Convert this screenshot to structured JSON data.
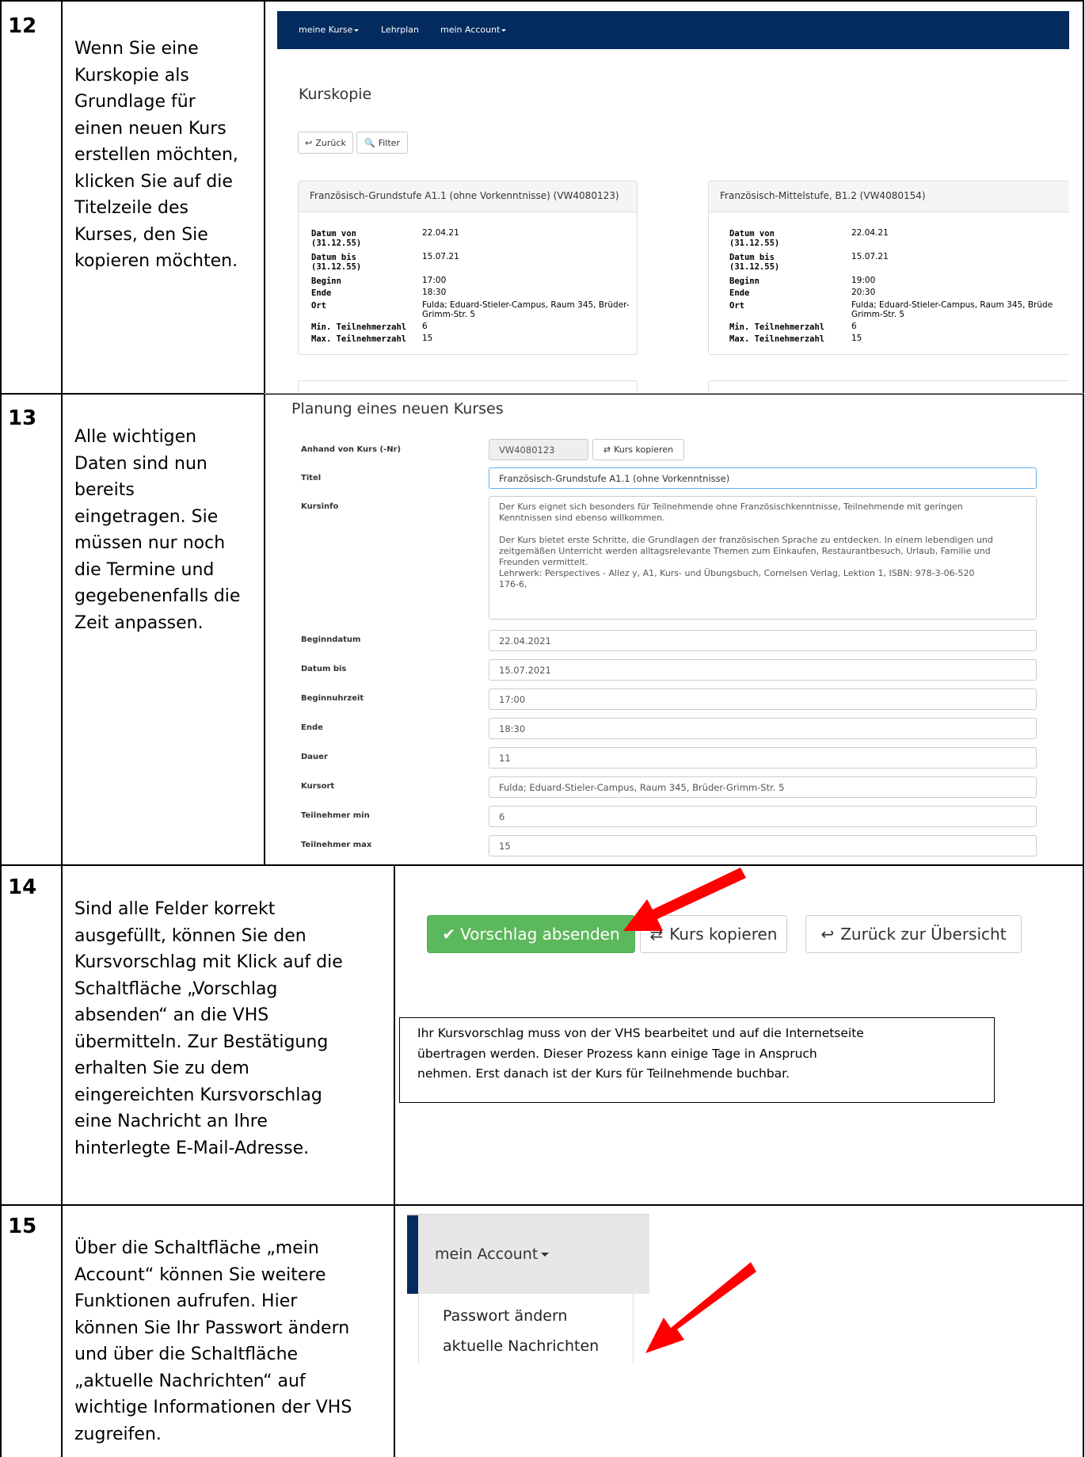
{
  "steps": [
    {
      "num": "12",
      "lines": [
        "Wenn Sie eine",
        "Kurskopie als",
        "Grundlage für",
        "einen neuen Kurs",
        "erstellen möchten,",
        "klicken Sie auf die",
        "Titelzeile des",
        "Kurses, den Sie",
        "kopieren möchten."
      ]
    },
    {
      "num": "13",
      "lines": [
        "Alle wichtigen",
        "Daten sind nun",
        "bereits",
        "eingetragen. Sie",
        "müssen nur noch",
        "die Termine und",
        "gegebenenfalls die",
        "Zeit anpassen."
      ]
    },
    {
      "num": "14",
      "lines": [
        "Sind alle Felder korrekt",
        "ausgefüllt, können Sie den",
        "Kursvorschlag mit Klick auf die",
        "Schaltfläche „Vorschlag",
        "absenden“ an die VHS",
        "übermitteln. Zur Bestätigung",
        "erhalten Sie zu dem",
        "eingereichten Kursvorschlag",
        "eine Nachricht an Ihre",
        "hinterlegte E-Mail-Adresse."
      ]
    },
    {
      "num": "15",
      "lines": [
        "Über die Schaltfläche „mein",
        "Account“ können Sie weitere",
        "Funktionen aufrufen. Hier",
        "können Sie Ihr Passwort ändern",
        "und über die Schaltfläche",
        "„aktuelle Nachrichten“ auf",
        "wichtige Informationen der VHS",
        "zugreifen."
      ]
    }
  ],
  "shot12": {
    "nav": [
      "meine Kurse",
      "Lehrplan",
      "mein Account"
    ],
    "title": "Kurskopie",
    "back_label": "Zurück",
    "filter_label": "Filter",
    "labels": {
      "von": "Datum von",
      "von2": "(31.12.55)",
      "bis": "Datum bis",
      "bis2": "(31.12.55)",
      "beginn": "Beginn",
      "ende": "Ende",
      "ort": "Ort",
      "min": "Min. Teilnehmerzahl",
      "max": "Max. Teilnehmerzahl"
    },
    "cards": [
      {
        "title": "Französisch-Grundstufe A1.1 (ohne Vorkenntnisse) (VW4080123)",
        "von": "22.04.21",
        "bis": "15.07.21",
        "beginn": "17:00",
        "ende": "18:30",
        "ort1": "Fulda; Eduard-Stieler-Campus, Raum 345, Brüder-",
        "ort2": "Grimm-Str. 5",
        "min": "6",
        "max": "15"
      },
      {
        "title": "Französisch-Mittelstufe, B1.2 (VW4080154)",
        "von": "22.04.21",
        "bis": "15.07.21",
        "beginn": "19:00",
        "ende": "20:30",
        "ort1": "Fulda; Eduard-Stieler-Campus, Raum 345, Brüde",
        "ort2": "Grimm-Str. 5",
        "min": "6",
        "max": "15"
      }
    ]
  },
  "shot13": {
    "heading": "Planung eines neuen Kurses",
    "labels": {
      "anhand": "Anhand von Kurs (-Nr)",
      "titel": "Titel",
      "kursinfo": "Kursinfo",
      "beginndatum": "Beginndatum",
      "datumbis": "Datum bis",
      "beginnuhrzeit": "Beginnuhrzeit",
      "ende": "Ende",
      "dauer": "Dauer",
      "kursort": "Kursort",
      "tmin": "Teilnehmer min",
      "tmax": "Teilnehmer max"
    },
    "values": {
      "anhand": "VW4080123",
      "titel": "Französisch-Grundstufe A1.1 (ohne Vorkenntnisse)",
      "beginndatum": "22.04.2021",
      "datumbis": "15.07.2021",
      "beginnuhrzeit": "17:00",
      "ende": "18:30",
      "dauer": "11",
      "kursort": "Fulda; Eduard-Stieler-Campus, Raum 345, Brüder-Grimm-Str. 5",
      "tmin": "6",
      "tmax": "15"
    },
    "copy_label": "Kurs kopieren",
    "kursinfo_lines": [
      "Der Kurs eignet sich besonders für Teilnehmende ohne Französischkenntnisse, Teilnehmende mit geringen",
      "Kenntnissen sind ebenso willkommen.",
      "",
      "Der Kurs bietet erste Schritte, die Grundlagen der französischen Sprache zu entdecken. In einem lebendigen und",
      "zeitgemäßen Unterricht werden alltagsrelevante Themen zum Einkaufen, Restaurantbesuch, Urlaub, Familie und",
      "Freunden vermittelt.",
      "Lehrwerk: Perspectives - Allez y, A1, Kurs- und Übungsbuch, Cornelsen Verlag, Lektion 1, ISBN: 978-3-06-520",
      "176-6,"
    ]
  },
  "shot14": {
    "submit_label": "Vorschlag absenden",
    "copy_label": "Kurs kopieren",
    "back_label": "Zurück zur Übersicht",
    "note_lines": [
      "Ihr Kursvorschlag muss von der VHS bearbeitet und auf die Internetseite",
      "übertragen werden. Dieser Prozess kann einige Tage in Anspruch",
      "nehmen. Erst danach ist der Kurs für Teilnehmende buchbar."
    ],
    "colors": {
      "success": "#5CB85C",
      "arrow": "#FF0000",
      "nav": "#032B5E"
    }
  },
  "shot15": {
    "account_label": "mein Account",
    "items": [
      "Passwort ändern",
      "aktuelle Nachrichten"
    ]
  }
}
